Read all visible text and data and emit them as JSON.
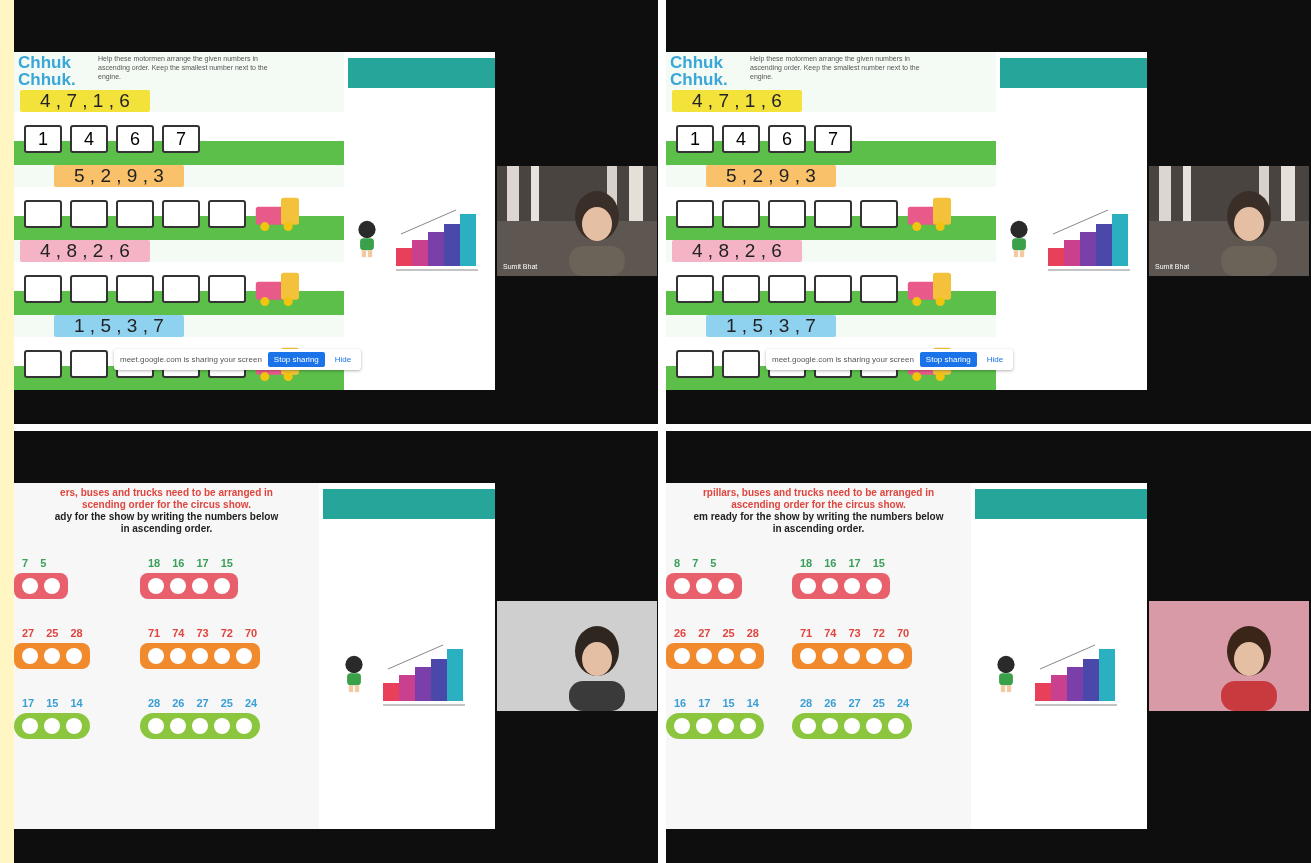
{
  "panels": [
    {
      "kind": "trains",
      "title": [
        "Chhuk",
        "Chhuk."
      ],
      "instruction": "Help these motormen arrange the given numbers in ascending order. Keep the smallest number next to the engine.",
      "rows": [
        {
          "strip": "4 , 7 , 1 , 6",
          "color": "#f3e23a",
          "cars": [
            {
              "kind": "numbered",
              "label": "1"
            },
            {
              "kind": "numbered",
              "label": "4"
            },
            {
              "kind": "numbered",
              "label": "6"
            },
            {
              "kind": "numbered",
              "label": "7"
            }
          ]
        },
        {
          "strip": "5 , 2 , 9 , 3",
          "color": "#f8c16a",
          "cars": [
            {
              "kind": "blank"
            },
            {
              "kind": "blank"
            },
            {
              "kind": "blank"
            },
            {
              "kind": "blank"
            },
            {
              "kind": "blank"
            }
          ]
        },
        {
          "strip": "4 , 8 , 2 , 6",
          "color": "#f5b3c6",
          "cars": [
            {
              "kind": "blank"
            },
            {
              "kind": "blank"
            },
            {
              "kind": "blank"
            },
            {
              "kind": "blank"
            },
            {
              "kind": "blank"
            }
          ]
        },
        {
          "strip": "1 , 5 , 3 , 7",
          "color": "#8fd2ef",
          "cars": [
            {
              "kind": "blank"
            },
            {
              "kind": "blank"
            },
            {
              "kind": "blank"
            },
            {
              "kind": "blank"
            },
            {
              "kind": "blank"
            }
          ]
        }
      ],
      "share_bar": {
        "message": "meet.google.com is sharing your screen",
        "stop": "Stop sharing",
        "hide": "Hide"
      },
      "video": {
        "name": "Sumit Bhat"
      }
    },
    {
      "kind": "trains",
      "title": [
        "Chhuk",
        "Chhuk."
      ],
      "instruction": "Help these motormen arrange the given numbers in ascending order. Keep the smallest number next to the engine.",
      "rows": [
        {
          "strip": "4 , 7 , 1 , 6",
          "color": "#f3e23a",
          "cars": [
            {
              "kind": "numbered",
              "label": "1"
            },
            {
              "kind": "numbered",
              "label": "4"
            },
            {
              "kind": "numbered",
              "label": "6"
            },
            {
              "kind": "numbered",
              "label": "7"
            }
          ]
        },
        {
          "strip": "5 , 2 , 9 , 3",
          "color": "#f8c16a",
          "cars": [
            {
              "kind": "blank"
            },
            {
              "kind": "blank"
            },
            {
              "kind": "blank"
            },
            {
              "kind": "blank"
            },
            {
              "kind": "blank"
            }
          ]
        },
        {
          "strip": "4 , 8 , 2 , 6",
          "color": "#f5b3c6",
          "cars": [
            {
              "kind": "blank"
            },
            {
              "kind": "blank"
            },
            {
              "kind": "blank"
            },
            {
              "kind": "blank"
            },
            {
              "kind": "blank"
            }
          ]
        },
        {
          "strip": "1 , 5 , 3 , 7",
          "color": "#8fd2ef",
          "cars": [
            {
              "kind": "blank"
            },
            {
              "kind": "blank"
            },
            {
              "kind": "blank"
            },
            {
              "kind": "blank"
            },
            {
              "kind": "blank"
            }
          ]
        }
      ],
      "share_bar": {
        "message": "meet.google.com is sharing your screen",
        "stop": "Stop sharing",
        "hide": "Hide"
      },
      "video": {
        "name": "Sumit Bhat"
      }
    },
    {
      "kind": "circus",
      "lines": [
        {
          "text": "ers, buses and trucks need to be arranged in",
          "color": "#e0453f"
        },
        {
          "text": "scending order for the circus show.",
          "color": "#e0453f"
        },
        {
          "text": "ady for the show by writing the numbers below",
          "color": "#222222"
        },
        {
          "text": "in ascending order.",
          "color": "#222222"
        }
      ],
      "groups": [
        {
          "kind": "train",
          "numbers": [
            "7",
            "5"
          ]
        },
        {
          "kind": "train",
          "numbers": [
            "18",
            "16",
            "17",
            "15"
          ]
        },
        {
          "kind": "bus",
          "numbers": [
            "27",
            "25",
            "28"
          ]
        },
        {
          "kind": "bus",
          "numbers": [
            "71",
            "74",
            "73",
            "72",
            "70"
          ]
        },
        {
          "kind": "caterpillar",
          "numbers": [
            "17",
            "15",
            "14"
          ]
        },
        {
          "kind": "caterpillar",
          "numbers": [
            "28",
            "26",
            "27",
            "25",
            "24"
          ]
        }
      ]
    },
    {
      "kind": "circus",
      "lines": [
        {
          "text": "rpillars, buses and trucks need to be arranged in",
          "color": "#e0453f"
        },
        {
          "text": "ascending order for the circus show.",
          "color": "#e0453f"
        },
        {
          "text": "em ready for the show by writing the numbers below",
          "color": "#222222"
        },
        {
          "text": "in ascending order.",
          "color": "#222222"
        }
      ],
      "groups": [
        {
          "kind": "train",
          "numbers": [
            "8",
            "7",
            "5"
          ]
        },
        {
          "kind": "train",
          "numbers": [
            "18",
            "16",
            "17",
            "15"
          ]
        },
        {
          "kind": "bus",
          "numbers": [
            "26",
            "27",
            "25",
            "28"
          ]
        },
        {
          "kind": "bus",
          "numbers": [
            "71",
            "74",
            "73",
            "72",
            "70"
          ]
        },
        {
          "kind": "caterpillar",
          "numbers": [
            "16",
            "17",
            "15",
            "14"
          ]
        },
        {
          "kind": "caterpillar",
          "numbers": [
            "28",
            "26",
            "27",
            "25",
            "24"
          ]
        }
      ]
    }
  ]
}
